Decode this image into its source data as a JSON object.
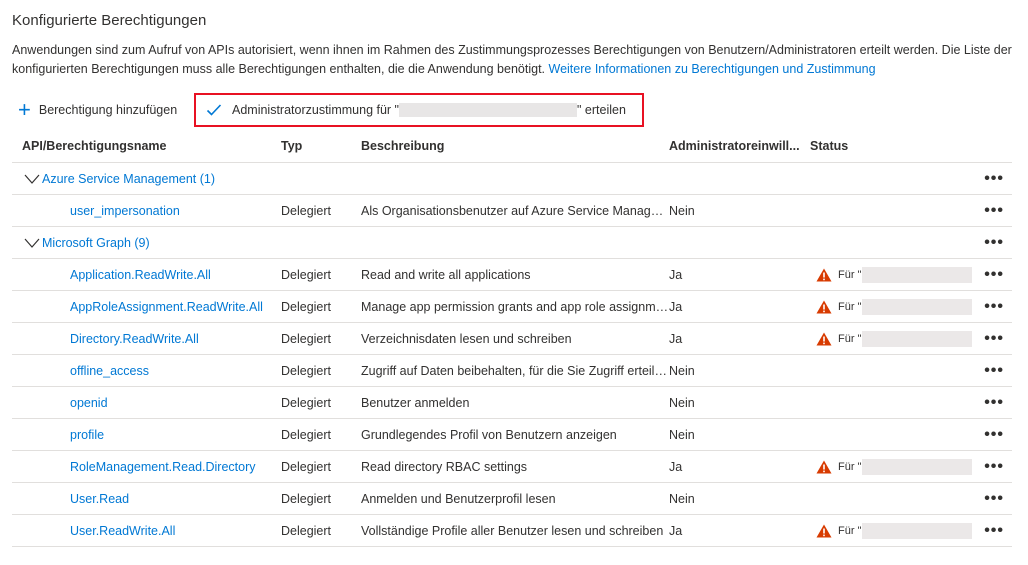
{
  "page": {
    "title": "Konfigurierte Berechtigungen",
    "description": "Anwendungen sind zum Aufruf von APIs autorisiert, wenn ihnen im Rahmen des Zustimmungsprozesses Berechtigungen von Benutzern/Administratoren erteilt werden. Die Liste der konfigurierten Berechtigungen muss alle Berechtigungen enthalten, die die Anwendung benötigt.",
    "link": "Weitere Informationen zu Berechtigungen und Zustimmung"
  },
  "toolbar": {
    "add_label": "Berechtigung hinzufügen",
    "consent_prefix": "Administratorzustimmung für \"",
    "consent_suffix": "\" erteilen"
  },
  "columns": {
    "name": "API/Berechtigungsname",
    "type": "Typ",
    "description": "Beschreibung",
    "admin": "Administratoreinwill...",
    "status": "Status"
  },
  "more_label": "•••",
  "status_prefix": "Für \"",
  "groups": [
    {
      "label": "Azure Service Management (1)"
    },
    {
      "label": "Microsoft Graph (9)"
    }
  ],
  "permissions": [
    {
      "name": "user_impersonation",
      "type": "Delegiert",
      "description": "Als Organisationsbenutzer auf Azure Service Management zugreifen",
      "admin": "Nein"
    },
    {
      "name": "Application.ReadWrite.All",
      "type": "Delegiert",
      "description": "Read and write all applications",
      "admin": "Ja"
    },
    {
      "name": "AppRoleAssignment.ReadWrite.All",
      "type": "Delegiert",
      "description": "Manage app permission grants and app role assignments",
      "admin": "Ja"
    },
    {
      "name": "Directory.ReadWrite.All",
      "type": "Delegiert",
      "description": "Verzeichnisdaten lesen und schreiben",
      "admin": "Ja"
    },
    {
      "name": "offline_access",
      "type": "Delegiert",
      "description": "Zugriff auf Daten beibehalten, für die Sie Zugriff erteilt haben",
      "admin": "Nein"
    },
    {
      "name": "openid",
      "type": "Delegiert",
      "description": "Benutzer anmelden",
      "admin": "Nein"
    },
    {
      "name": "profile",
      "type": "Delegiert",
      "description": "Grundlegendes Profil von Benutzern anzeigen",
      "admin": "Nein"
    },
    {
      "name": "RoleManagement.Read.Directory",
      "type": "Delegiert",
      "description": "Read directory RBAC settings",
      "admin": "Ja"
    },
    {
      "name": "User.Read",
      "type": "Delegiert",
      "description": "Anmelden und Benutzerprofil lesen",
      "admin": "Nein"
    },
    {
      "name": "User.ReadWrite.All",
      "type": "Delegiert",
      "description": "Vollständige Profile aller Benutzer lesen und schreiben",
      "admin": "Ja"
    }
  ],
  "colors": {
    "accent": "#0078d4",
    "warning": "#d83b01",
    "highlight_border": "#e81123"
  }
}
